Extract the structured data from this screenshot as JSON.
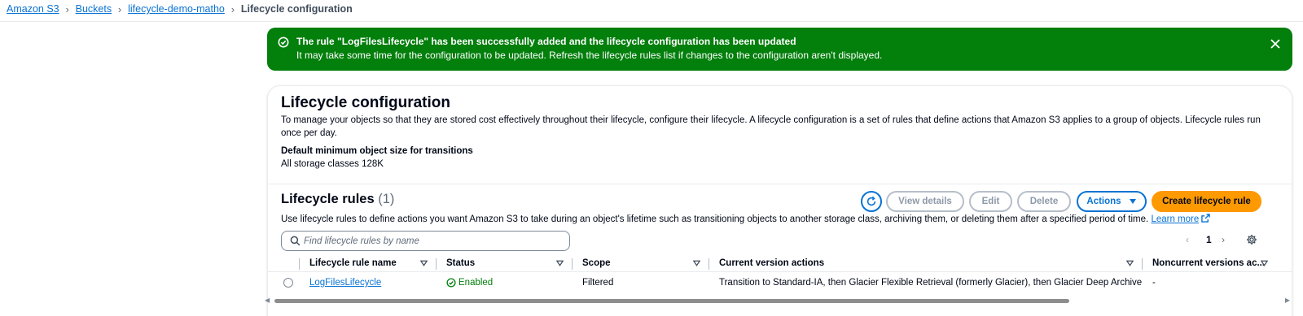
{
  "breadcrumb": {
    "items": [
      "Amazon S3",
      "Buckets",
      "lifecycle-demo-matho"
    ],
    "current": "Lifecycle configuration"
  },
  "flash": {
    "title": "The rule \"LogFilesLifecycle\" has been successfully added and the lifecycle configuration has been updated",
    "message": "It may take some time for the configuration to be updated. Refresh the lifecycle rules list if changes to the configuration aren't displayed.",
    "color": "#037f0c"
  },
  "lifecycle": {
    "title": "Lifecycle configuration",
    "description": "To manage your objects so that they are stored cost effectively throughout their lifecycle, configure their lifecycle. A lifecycle configuration is a set of rules that define actions that Amazon S3 applies to a group of objects. Lifecycle rules run once per day.",
    "min_size_label": "Default minimum object size for transitions",
    "min_size_value": "All storage classes 128K"
  },
  "rules": {
    "title": "Lifecycle rules",
    "count": "(1)",
    "description": "Use lifecycle rules to define actions you want Amazon S3 to take during an object's lifetime such as transitioning objects to another storage class, archiving them, or deleting them after a specified period of time.",
    "learn_more": "Learn more",
    "buttons": {
      "view_details": "View details",
      "edit": "Edit",
      "delete": "Delete",
      "actions": "Actions",
      "create": "Create lifecycle rule"
    },
    "search_placeholder": "Find lifecycle rules by name",
    "page": "1",
    "columns": [
      "Lifecycle rule name",
      "Status",
      "Scope",
      "Current version actions",
      "Noncurrent versions ac..."
    ],
    "rows": [
      {
        "name": "LogFilesLifecycle",
        "status": "Enabled",
        "scope": "Filtered",
        "current_actions": "Transition to Standard-IA, then Glacier Flexible Retrieval (formerly Glacier), then Glacier Deep Archive",
        "noncurrent_actions": "-"
      }
    ]
  },
  "colors": {
    "link": "#0972d3",
    "success": "#037f0c",
    "primary_button": "#ff9900"
  }
}
